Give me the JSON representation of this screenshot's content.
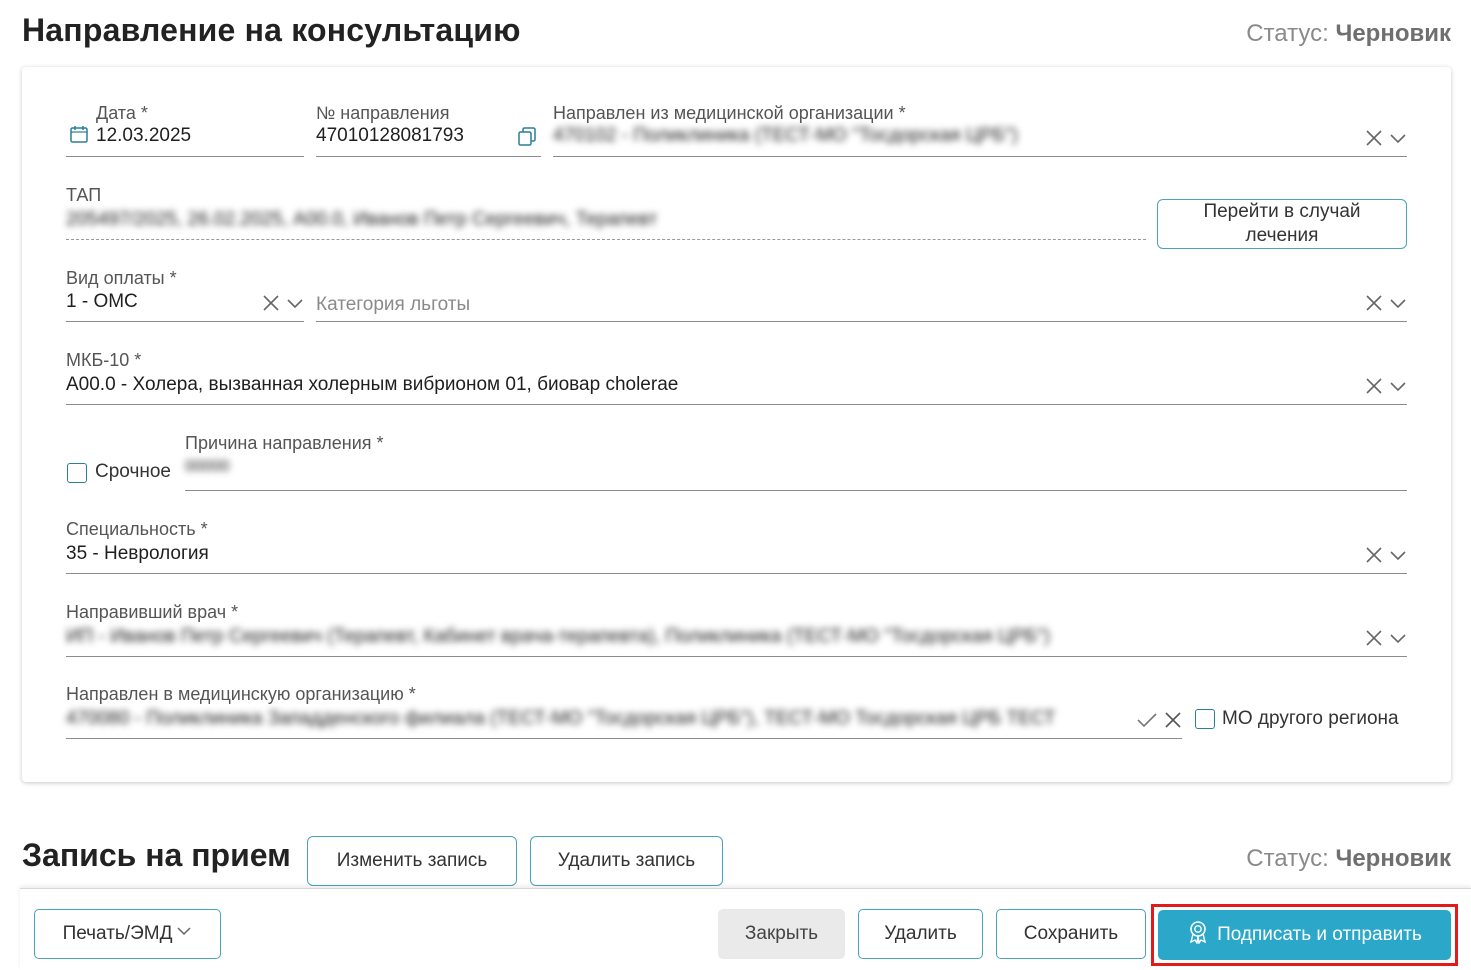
{
  "header": {
    "title": "Направление на консультацию",
    "status_label": "Статус:",
    "status_value": "Черновик"
  },
  "form": {
    "date": {
      "label": "Дата *",
      "value": "12.03.2025"
    },
    "referral_number": {
      "label": "№ направления",
      "value": "47010128081793"
    },
    "from_org": {
      "label": "Направлен из медицинской организации *",
      "value": "470102 - Поликлиника (ТЕСТ-МО \"Тосдорская ЦРБ\")"
    },
    "tap": {
      "label": "ТАП",
      "value": "205497/2025, 26.02.2025, А00.0, Иванов Петр Сергеевич, Терапевт"
    },
    "goto_case_button": "Перейти в случай лечения",
    "payment_type": {
      "label": "Вид оплаты *",
      "value": "1 - ОМС"
    },
    "benefit_category": {
      "placeholder": "Категория льготы"
    },
    "icd10": {
      "label": "МКБ-10 *",
      "value": "A00.0 - Холера, вызванная холерным вибрионом 01, биовар cholerae"
    },
    "urgent": {
      "label": "Срочное",
      "checked": false
    },
    "reason": {
      "label": "Причина направления *",
      "value": "00000"
    },
    "specialty": {
      "label": "Специальность *",
      "value": "35 - Неврология"
    },
    "referring_doctor": {
      "label": "Направивший врач *",
      "value": "ИП - Иванов Петр Сергеевич (Терапевт, Кабинет врача-терапевта), Поликлиника (ТЕСТ-МО \"Тосдорская ЦРБ\")"
    },
    "to_org": {
      "label": "Направлен в медицинскую организацию *",
      "value": "470080 - Поликлиника Западденского филиала (ТЕСТ-МО \"Тосдорская ЦРБ\"), ТЕСТ-МО Тосдорская ЦРБ ТЕСТ"
    },
    "other_region": {
      "label": "МО другого региона",
      "checked": false
    }
  },
  "appointment": {
    "title": "Запись на прием",
    "change_button": "Изменить запись",
    "delete_button": "Удалить запись",
    "status_label": "Статус:",
    "status_value": "Черновик"
  },
  "footer": {
    "print_button": "Печать/ЭМД",
    "close_button": "Закрыть",
    "delete_button": "Удалить",
    "save_button": "Сохранить",
    "sign_send_button": "Подписать и отправить"
  },
  "colors": {
    "accent": "#2ba7c9",
    "outline": "#4aa3b8",
    "highlight": "#e21a1a",
    "status_value": "#6f6f6f"
  }
}
